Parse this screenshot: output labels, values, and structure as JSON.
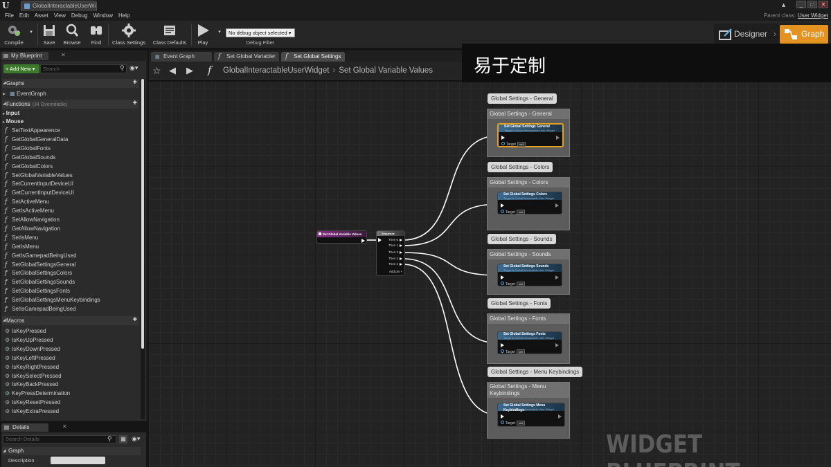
{
  "window": {
    "doc_tab": "GlobalInteractableUserWi",
    "parent_class_label": "Parent class:",
    "parent_class_value": "User Widget"
  },
  "menu": [
    "File",
    "Edit",
    "Asset",
    "View",
    "Debug",
    "Window",
    "Help"
  ],
  "toolbar": {
    "compile": "Compile",
    "save": "Save",
    "browse": "Browse",
    "find": "Find",
    "class_settings": "Class Settings",
    "class_defaults": "Class Defaults",
    "play": "Play",
    "debug_select": "No debug object selected ▾",
    "debug_filter": "Debug Filter",
    "designer": "Designer",
    "graph": "Graph"
  },
  "my_blueprint": {
    "tab": "My Blueprint",
    "add_new": "+ Add New ▾",
    "search_placeholder": "Search",
    "graphs_header": "Graphs",
    "graphs": [
      "EventGraph"
    ],
    "functions_header": "Functions",
    "functions_overridable": "(34 Overridable)",
    "categories": [
      "Input",
      "Mouse"
    ],
    "functions": [
      "SetTextAppearence",
      "GetGlobalGeneralData",
      "GetGlobalFonts",
      "GetGlobalSounds",
      "GetGlobalColors",
      "SetGlobalVariableValues",
      "SetCurrentInputDeviceUI",
      "GetCurrentInputDeviceUI",
      "SetActiveMenu",
      "GetIsActiveMenu",
      "SetAllowNavigation",
      "GetAllowNavigation",
      "SetIsMenu",
      "GetIsMenu",
      "GetIsGamepadBeingUsed",
      "SetGlobalSettingsGeneral",
      "SetGlobalSettingsColors",
      "SetGlobalSettingsSounds",
      "SetGlobalSettingsFonts",
      "SetGlobalSettingsMenuKeybindings",
      "SetIsGamepadBeingUsed"
    ],
    "macros_header": "Macros",
    "macros": [
      "IsKeyPressed",
      "IsKeyUpPressed",
      "IsKeyDownPressed",
      "IsKeyLeftPressed",
      "IsKeyRightPressed",
      "IsKeySelectPressed",
      "IsKeyBackPressed",
      "KeyPressDetermination",
      "IsKeyResetPressed",
      "IsKeyExtraPressed"
    ]
  },
  "details": {
    "tab": "Details",
    "search_placeholder": "Search Details",
    "graph_header": "Graph",
    "description_label": "Description"
  },
  "graph_tabs": [
    "Event Graph",
    "Set Global Variable",
    "Set Global Settings"
  ],
  "breadcrumb": {
    "root": "GlobalInteractableUserWidget",
    "current": "Set Global Variable Values"
  },
  "caption": "易于定制",
  "nodes": {
    "event": "Set Global Variable Values",
    "sequence": "Sequence",
    "sequence_pins": [
      "Then 0",
      "Then 1",
      "Then 2",
      "Then 3",
      "Then 4"
    ],
    "add_pin": "Add pin +",
    "target": "Target",
    "self": "self",
    "function_sub": "Target is Global Interactable User Widget"
  },
  "comments": [
    {
      "bubble": "Global Settings - General",
      "title": "Global Settings - General",
      "func": "Set Global Settings General"
    },
    {
      "bubble": "Global Settings - Colors",
      "title": "Global Settings - Colors",
      "func": "Set Global Settings Colors"
    },
    {
      "bubble": "Global Settings - Sounds",
      "title": "Global Settings - Sounds",
      "func": "Set Global Settings Sounds"
    },
    {
      "bubble": "Global Settings - Fonts",
      "title": "Global Settings - Fonts",
      "func": "Set Global Settings Fonts"
    },
    {
      "bubble": "Global Settings - Menu Keybindings",
      "title": "Global Settings - Menu Keybindings",
      "func": "Set Global Settings Menu Keybindings"
    }
  ],
  "watermark": "WIDGET BLUEPRINT"
}
